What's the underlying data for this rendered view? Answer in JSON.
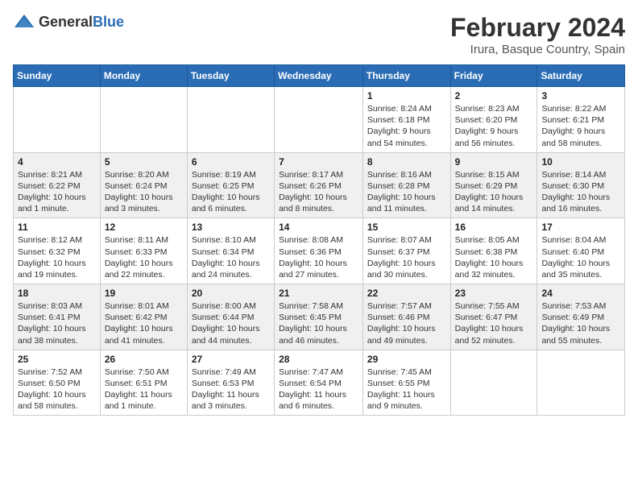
{
  "header": {
    "logo_general": "General",
    "logo_blue": "Blue",
    "month_title": "February 2024",
    "location": "Irura, Basque Country, Spain"
  },
  "columns": [
    "Sunday",
    "Monday",
    "Tuesday",
    "Wednesday",
    "Thursday",
    "Friday",
    "Saturday"
  ],
  "weeks": [
    [
      {
        "day": "",
        "info": ""
      },
      {
        "day": "",
        "info": ""
      },
      {
        "day": "",
        "info": ""
      },
      {
        "day": "",
        "info": ""
      },
      {
        "day": "1",
        "info": "Sunrise: 8:24 AM\nSunset: 6:18 PM\nDaylight: 9 hours\nand 54 minutes."
      },
      {
        "day": "2",
        "info": "Sunrise: 8:23 AM\nSunset: 6:20 PM\nDaylight: 9 hours\nand 56 minutes."
      },
      {
        "day": "3",
        "info": "Sunrise: 8:22 AM\nSunset: 6:21 PM\nDaylight: 9 hours\nand 58 minutes."
      }
    ],
    [
      {
        "day": "4",
        "info": "Sunrise: 8:21 AM\nSunset: 6:22 PM\nDaylight: 10 hours\nand 1 minute."
      },
      {
        "day": "5",
        "info": "Sunrise: 8:20 AM\nSunset: 6:24 PM\nDaylight: 10 hours\nand 3 minutes."
      },
      {
        "day": "6",
        "info": "Sunrise: 8:19 AM\nSunset: 6:25 PM\nDaylight: 10 hours\nand 6 minutes."
      },
      {
        "day": "7",
        "info": "Sunrise: 8:17 AM\nSunset: 6:26 PM\nDaylight: 10 hours\nand 8 minutes."
      },
      {
        "day": "8",
        "info": "Sunrise: 8:16 AM\nSunset: 6:28 PM\nDaylight: 10 hours\nand 11 minutes."
      },
      {
        "day": "9",
        "info": "Sunrise: 8:15 AM\nSunset: 6:29 PM\nDaylight: 10 hours\nand 14 minutes."
      },
      {
        "day": "10",
        "info": "Sunrise: 8:14 AM\nSunset: 6:30 PM\nDaylight: 10 hours\nand 16 minutes."
      }
    ],
    [
      {
        "day": "11",
        "info": "Sunrise: 8:12 AM\nSunset: 6:32 PM\nDaylight: 10 hours\nand 19 minutes."
      },
      {
        "day": "12",
        "info": "Sunrise: 8:11 AM\nSunset: 6:33 PM\nDaylight: 10 hours\nand 22 minutes."
      },
      {
        "day": "13",
        "info": "Sunrise: 8:10 AM\nSunset: 6:34 PM\nDaylight: 10 hours\nand 24 minutes."
      },
      {
        "day": "14",
        "info": "Sunrise: 8:08 AM\nSunset: 6:36 PM\nDaylight: 10 hours\nand 27 minutes."
      },
      {
        "day": "15",
        "info": "Sunrise: 8:07 AM\nSunset: 6:37 PM\nDaylight: 10 hours\nand 30 minutes."
      },
      {
        "day": "16",
        "info": "Sunrise: 8:05 AM\nSunset: 6:38 PM\nDaylight: 10 hours\nand 32 minutes."
      },
      {
        "day": "17",
        "info": "Sunrise: 8:04 AM\nSunset: 6:40 PM\nDaylight: 10 hours\nand 35 minutes."
      }
    ],
    [
      {
        "day": "18",
        "info": "Sunrise: 8:03 AM\nSunset: 6:41 PM\nDaylight: 10 hours\nand 38 minutes."
      },
      {
        "day": "19",
        "info": "Sunrise: 8:01 AM\nSunset: 6:42 PM\nDaylight: 10 hours\nand 41 minutes."
      },
      {
        "day": "20",
        "info": "Sunrise: 8:00 AM\nSunset: 6:44 PM\nDaylight: 10 hours\nand 44 minutes."
      },
      {
        "day": "21",
        "info": "Sunrise: 7:58 AM\nSunset: 6:45 PM\nDaylight: 10 hours\nand 46 minutes."
      },
      {
        "day": "22",
        "info": "Sunrise: 7:57 AM\nSunset: 6:46 PM\nDaylight: 10 hours\nand 49 minutes."
      },
      {
        "day": "23",
        "info": "Sunrise: 7:55 AM\nSunset: 6:47 PM\nDaylight: 10 hours\nand 52 minutes."
      },
      {
        "day": "24",
        "info": "Sunrise: 7:53 AM\nSunset: 6:49 PM\nDaylight: 10 hours\nand 55 minutes."
      }
    ],
    [
      {
        "day": "25",
        "info": "Sunrise: 7:52 AM\nSunset: 6:50 PM\nDaylight: 10 hours\nand 58 minutes."
      },
      {
        "day": "26",
        "info": "Sunrise: 7:50 AM\nSunset: 6:51 PM\nDaylight: 11 hours\nand 1 minute."
      },
      {
        "day": "27",
        "info": "Sunrise: 7:49 AM\nSunset: 6:53 PM\nDaylight: 11 hours\nand 3 minutes."
      },
      {
        "day": "28",
        "info": "Sunrise: 7:47 AM\nSunset: 6:54 PM\nDaylight: 11 hours\nand 6 minutes."
      },
      {
        "day": "29",
        "info": "Sunrise: 7:45 AM\nSunset: 6:55 PM\nDaylight: 11 hours\nand 9 minutes."
      },
      {
        "day": "",
        "info": ""
      },
      {
        "day": "",
        "info": ""
      }
    ]
  ]
}
